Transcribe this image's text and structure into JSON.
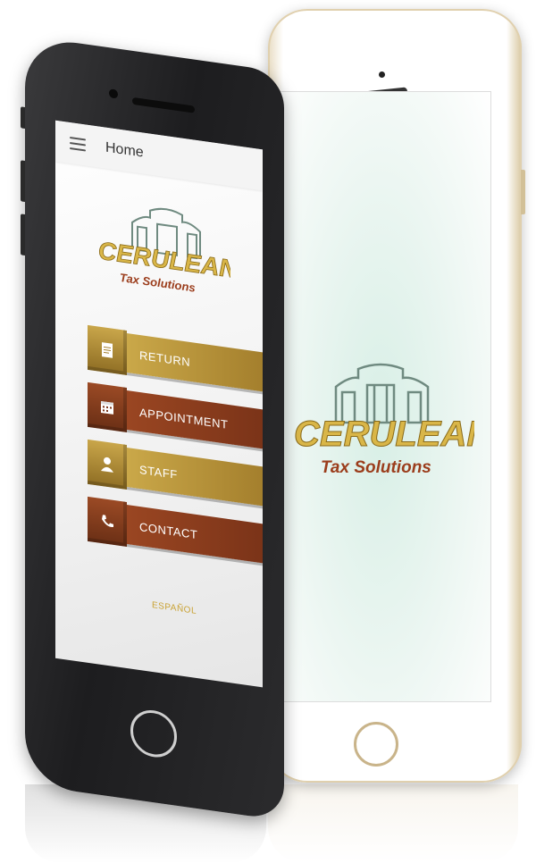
{
  "left_screen": {
    "app_bar": {
      "title": "Home",
      "menu_icon": "hamburger-menu-icon"
    },
    "logo": {
      "brand": "CERULEAN",
      "tagline": "Tax Solutions"
    },
    "menu": [
      {
        "label": "RETURN",
        "icon": "tax-form-icon",
        "style": "gold"
      },
      {
        "label": "APPOINTMENT",
        "icon": "calendar-icon",
        "style": "brown"
      },
      {
        "label": "STAFF",
        "icon": "person-icon",
        "style": "gold"
      },
      {
        "label": "CONTACT",
        "icon": "phone-icon",
        "style": "brown"
      }
    ],
    "language_link": "ESPAÑOL"
  },
  "right_screen": {
    "logo": {
      "brand": "CERULEAN",
      "tagline": "Tax Solutions"
    }
  },
  "colors": {
    "gold": "#c9a64a",
    "brown": "#8f3f1e",
    "building": "#6f8a80"
  }
}
